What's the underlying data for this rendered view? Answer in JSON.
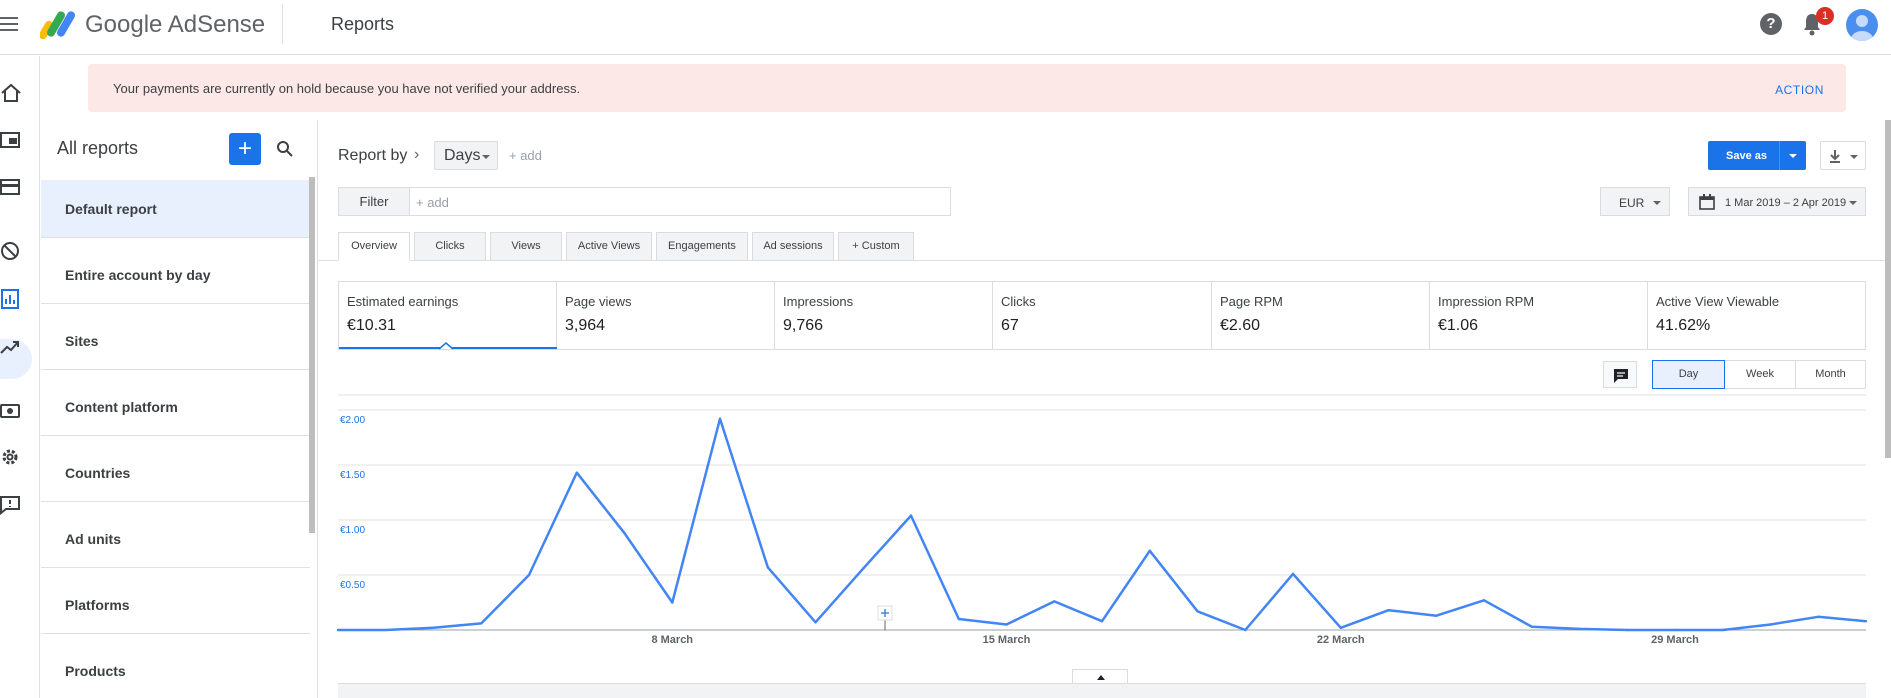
{
  "app": {
    "brand": "Google AdSense",
    "page_title": "Reports",
    "notification_count": "1"
  },
  "alert": {
    "message": "Your payments are currently on hold because you have not verified your address.",
    "action": "ACTION"
  },
  "rail": {
    "icons": [
      "home-icon",
      "ads-icon",
      "display-icon",
      "block-icon",
      "reports-icon",
      "optimization-icon",
      "payments-icon",
      "settings-icon",
      "feedback-icon"
    ],
    "active": "reports-icon"
  },
  "reports_panel": {
    "title": "All reports",
    "add_label": "+",
    "items": [
      {
        "label": "Default report",
        "active": true
      },
      {
        "label": "Entire account by day",
        "active": false
      },
      {
        "label": "Sites",
        "active": false
      },
      {
        "label": "Content platform",
        "active": false
      },
      {
        "label": "Countries",
        "active": false
      },
      {
        "label": "Ad units",
        "active": false
      },
      {
        "label": "Platforms",
        "active": false
      },
      {
        "label": "Products",
        "active": false
      }
    ]
  },
  "toolbar": {
    "report_by": "Report by",
    "dimension": "Days",
    "add_dimension": "+ add",
    "filter_label": "Filter",
    "filter_placeholder": "+ add",
    "save_as": "Save as",
    "currency": "EUR",
    "date_range": "1 Mar 2019 – 2 Apr 2019"
  },
  "tabs": [
    {
      "label": "Overview",
      "active": true
    },
    {
      "label": "Clicks",
      "active": false
    },
    {
      "label": "Views",
      "active": false
    },
    {
      "label": "Active Views",
      "active": false
    },
    {
      "label": "Engagements",
      "active": false
    },
    {
      "label": "Ad sessions",
      "active": false
    },
    {
      "label": "+ Custom",
      "active": false
    }
  ],
  "metrics": [
    {
      "label": "Estimated earnings",
      "value": "€10.31",
      "selected": true
    },
    {
      "label": "Page views",
      "value": "3,964"
    },
    {
      "label": "Impressions",
      "value": "9,766"
    },
    {
      "label": "Clicks",
      "value": "67"
    },
    {
      "label": "Page RPM",
      "value": "€2.60"
    },
    {
      "label": "Impression RPM",
      "value": "€1.06"
    },
    {
      "label": "Active View Viewable",
      "value": "41.62%"
    }
  ],
  "granularity": {
    "options": [
      "Day",
      "Week",
      "Month"
    ],
    "selected": "Day"
  },
  "colors": {
    "accent": "#1a73e8",
    "line": "#4285f4",
    "alert_bg": "#fce8e6"
  },
  "chart_data": {
    "type": "line",
    "x": [
      "1 Mar",
      "2 Mar",
      "3 Mar",
      "4 Mar",
      "5 Mar",
      "6 Mar",
      "7 Mar",
      "8 Mar",
      "9 Mar",
      "10 Mar",
      "11 Mar",
      "12 Mar",
      "13 Mar",
      "14 Mar",
      "15 Mar",
      "16 Mar",
      "17 Mar",
      "18 Mar",
      "19 Mar",
      "20 Mar",
      "21 Mar",
      "22 Mar",
      "23 Mar",
      "24 Mar",
      "25 Mar",
      "26 Mar",
      "27 Mar",
      "28 Mar",
      "29 Mar",
      "30 Mar",
      "31 Mar",
      "1 Apr",
      "2 Apr"
    ],
    "series": [
      {
        "values": [
          0.0,
          0.0,
          0.02,
          0.06,
          0.5,
          1.43,
          0.88,
          0.25,
          1.92,
          0.57,
          0.07,
          0.56,
          1.04,
          0.1,
          0.05,
          0.26,
          0.08,
          0.72,
          0.17,
          0.0,
          0.51,
          0.02,
          0.18,
          0.13,
          0.27,
          0.03,
          0.01,
          0.0,
          0.0,
          0.0,
          0.05,
          0.12,
          0.08
        ]
      }
    ],
    "xticks": [
      "8 March",
      "15 March",
      "22 March",
      "29 March"
    ],
    "yticks": [
      "€0.50",
      "€1.00",
      "€1.50",
      "€2.00"
    ],
    "ylim": [
      0,
      2.0
    ],
    "grid": true
  }
}
